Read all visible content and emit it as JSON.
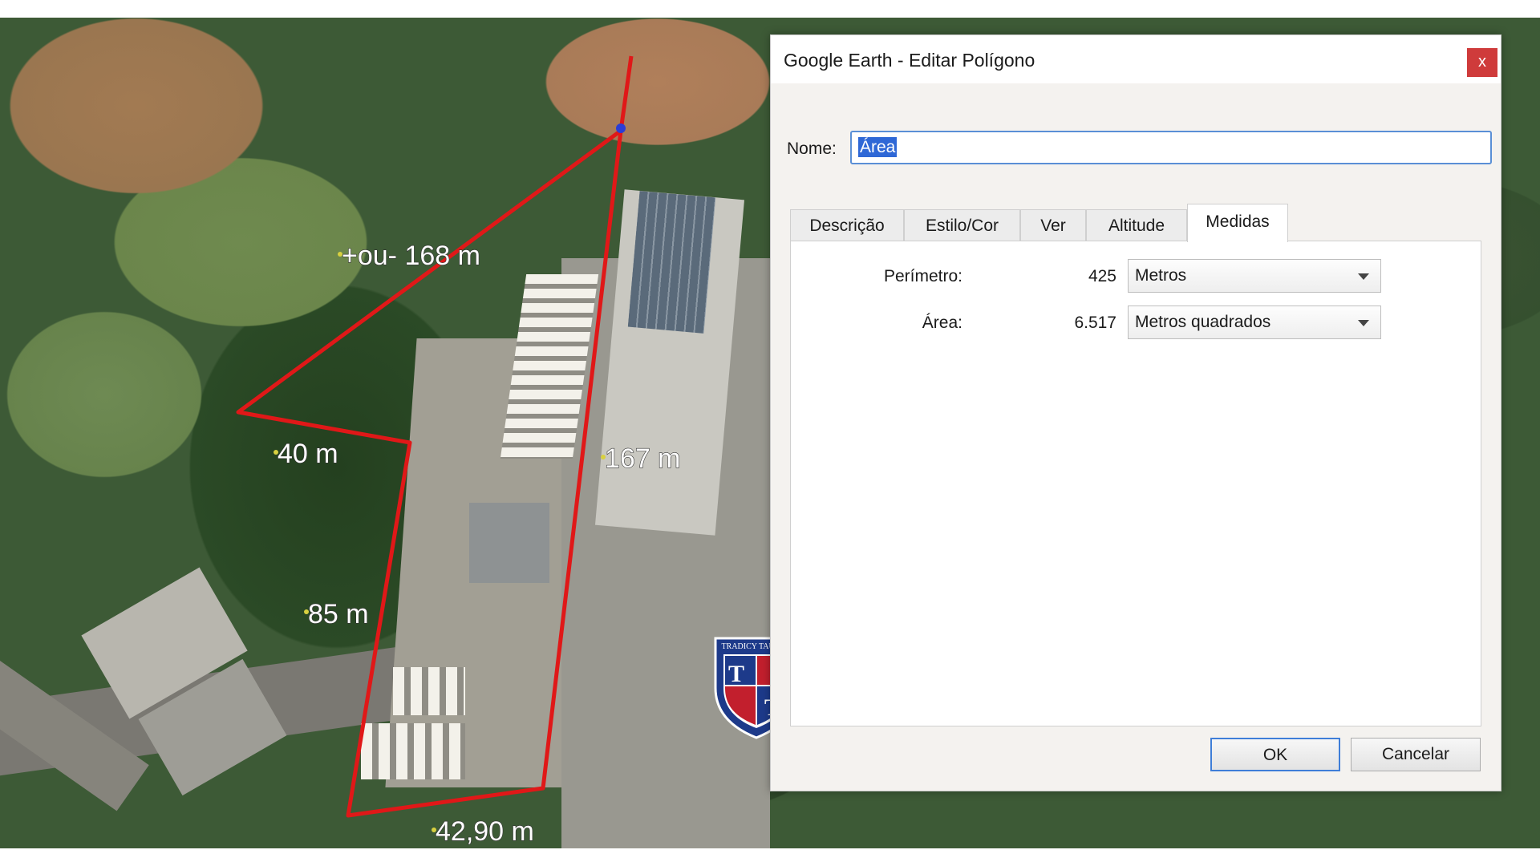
{
  "dialog": {
    "title": "Google Earth - Editar Polígono",
    "close_label": "x",
    "name_label": "Nome:",
    "name_value": "Área",
    "tabs": [
      {
        "label": "Descrição",
        "active": false
      },
      {
        "label": "Estilo/Cor",
        "active": false
      },
      {
        "label": "Ver",
        "active": false
      },
      {
        "label": "Altitude",
        "active": false
      },
      {
        "label": "Medidas",
        "active": true
      }
    ],
    "measures": {
      "perimeter_label": "Perímetro:",
      "perimeter_value": "425",
      "perimeter_unit": "Metros",
      "area_label": "Área:",
      "area_value": "6.517",
      "area_unit": "Metros quadrados"
    },
    "ok_label": "OK",
    "cancel_label": "Cancelar"
  },
  "map": {
    "labels": {
      "top": "+ou- 168 m",
      "left": "40 m",
      "right": "167 m",
      "lower_left": "85 m",
      "bottom": "42,90 m"
    },
    "polygon_color": "#e01818"
  },
  "logo": {
    "text": "TRADICY TAUNAY",
    "letter_top": "T",
    "letter_bottom": "T"
  }
}
